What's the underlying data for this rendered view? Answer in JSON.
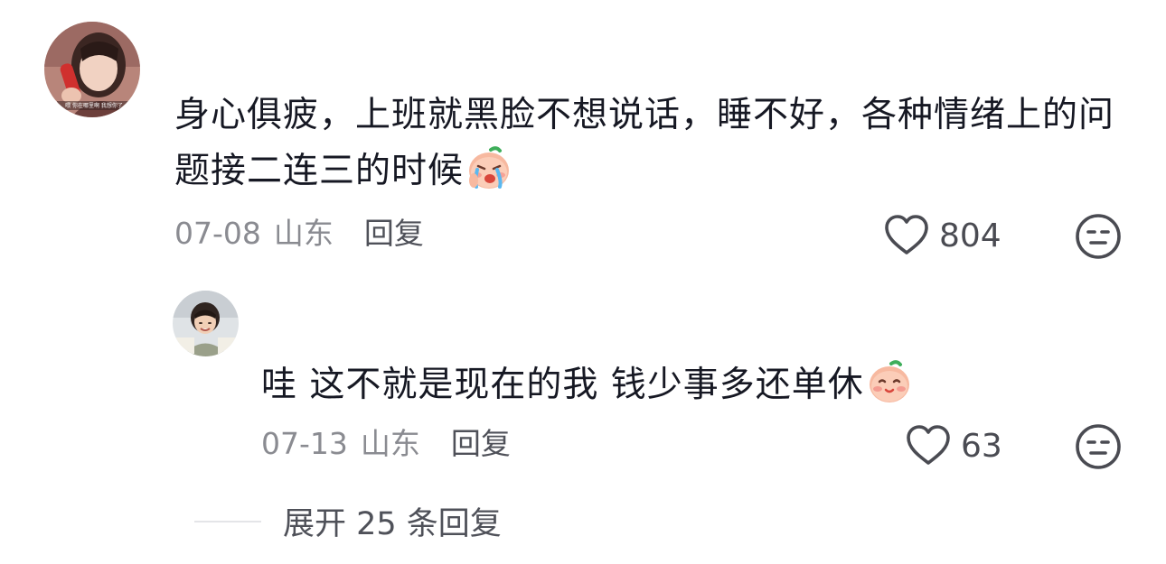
{
  "comment": {
    "text": "身心俱疲，上班就黑脸不想说话，睡不好，各种情绪上的问题接二连三的时候",
    "emoji": "crying-face-emoji",
    "date": "07-08",
    "region": "山东",
    "reply_label": "回复",
    "like_count": "804",
    "avatar_caption": "喂 你在哪里啊 我想你了"
  },
  "reply": {
    "text": "哇 这不就是现在的我 钱少事多还单休",
    "emoji": "blushing-face-emoji",
    "date": "07-13",
    "region": "山东",
    "reply_label": "回复",
    "like_count": "63"
  },
  "expand": {
    "label": "展开 25 条回复"
  },
  "colors": {
    "text": "#161823",
    "meta": "#8a8b91",
    "action": "#4f5159",
    "icon": "#4a4b52"
  }
}
